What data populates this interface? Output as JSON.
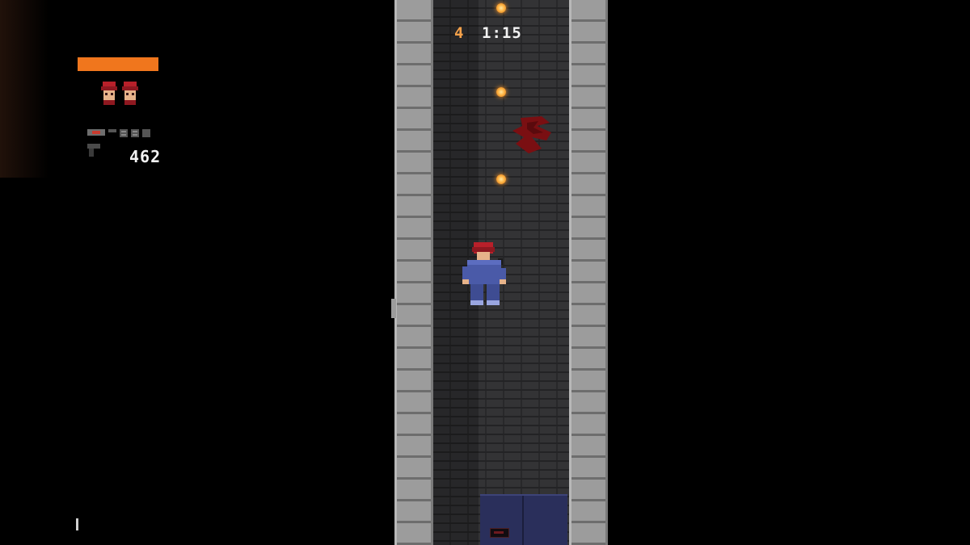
{
  "hud": {
    "level": "4",
    "timer": "1:15",
    "ammo": "462",
    "health_fraction": 1.0,
    "lives": 2
  },
  "colors": {
    "health": "#f0761d",
    "level_text": "#f4a14a",
    "timer_text": "#f2f2f2",
    "wall": "#9c9c9c",
    "floor": "#333335",
    "coin": "#ffb545",
    "blood": "#7a0f12",
    "player_shirt": "#4a5aa8",
    "player_hat": "#b8202a",
    "door": "#2a2f5b"
  },
  "icons": {
    "life": "player-head-icon",
    "weapon": "pistol-icon",
    "pickup": "coin-icon"
  }
}
